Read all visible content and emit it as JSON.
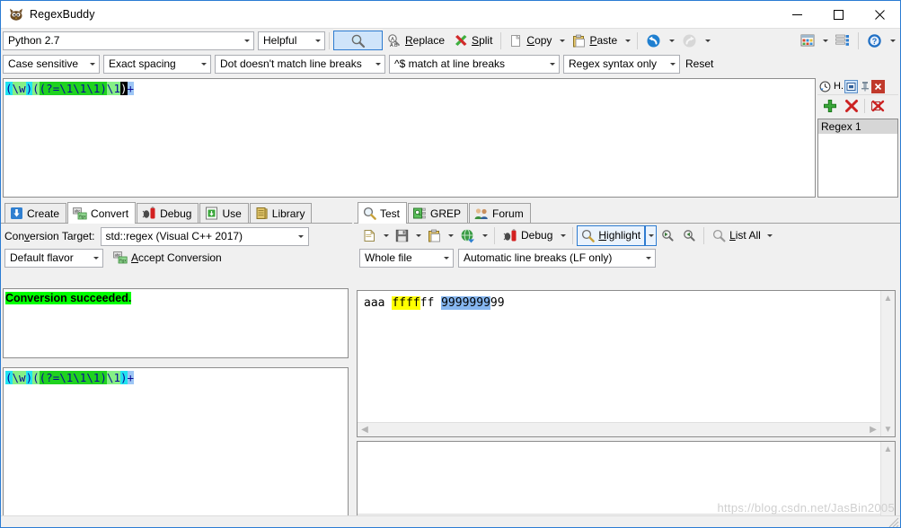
{
  "window": {
    "title": "RegexBuddy",
    "app_icon": "regexbuddy-owl-icon",
    "minimize_label": "Minimize",
    "maximize_label": "Maximize",
    "close_label": "Close"
  },
  "toolbar_main": {
    "flavor": "Python 2.7",
    "mode": "Helpful",
    "search_button": "search-icon",
    "replace_label": "Replace",
    "replace_underline": "R",
    "split_label": "Split",
    "split_underline": "S",
    "copy_label": "Copy",
    "copy_underline": "C",
    "paste_label": "Paste",
    "paste_underline": "P",
    "undo_label": "Undo",
    "redo_label": "Redo",
    "grid_label": "Layout",
    "list_label": "List",
    "help_label": "Help"
  },
  "toolbar_options": {
    "case": "Case sensitive",
    "spacing": "Exact spacing",
    "dot": "Dot doesn't match line breaks",
    "anchors": "^$ match at line breaks",
    "syntax": "Regex syntax only",
    "reset_label": "Reset"
  },
  "regex": {
    "tokens": [
      {
        "text": "(",
        "style": "cy"
      },
      {
        "text": "\\w",
        "style": "lgrn"
      },
      {
        "text": ")",
        "style": "cy"
      },
      {
        "text": "(",
        "style": "lgrn"
      },
      {
        "text": "(",
        "style": "grn"
      },
      {
        "text": "?=",
        "style": "grn"
      },
      {
        "text": "\\1\\1\\1",
        "style": "grn"
      },
      {
        "text": ")",
        "style": "grn"
      },
      {
        "text": "\\1",
        "style": "grn"
      },
      {
        "text": ")",
        "style": "cur"
      },
      {
        "text": "+",
        "style": "blu"
      }
    ],
    "plain": "(\\w)((?=\\1\\1\\1)\\1)+"
  },
  "regex_panel": {
    "header_label": "H.",
    "restore_label": "restore-icon",
    "pin_label": "pin-icon",
    "close_label": "close-icon",
    "add_label": "add-icon",
    "delete_label": "delete-icon",
    "delete_all_label": "delete-all-icon",
    "items": [
      {
        "label": "Regex 1",
        "selected": true
      }
    ]
  },
  "left_pane": {
    "tabs": [
      {
        "label": "Create",
        "icon": "create-icon",
        "selected": false
      },
      {
        "label": "Convert",
        "icon": "convert-icon",
        "selected": true
      },
      {
        "label": "Debug",
        "icon": "debug-icon",
        "selected": false
      },
      {
        "label": "Use",
        "icon": "use-icon",
        "selected": false
      },
      {
        "label": "Library",
        "icon": "library-icon",
        "selected": false
      }
    ],
    "conversion_target_label": "Conversion Target:",
    "conversion_target_underline": "v",
    "conversion_target_value": "std::regex (Visual C++ 2017)",
    "flavor_value": "Default flavor",
    "accept_label": "Accept Conversion",
    "accept_underline": "A",
    "status_message": "Conversion succeeded.",
    "status_bg": "#00ff00",
    "converted_regex": "(\\w)((?=\\1\\1\\1)\\1)+"
  },
  "right_pane": {
    "tabs": [
      {
        "label": "Test",
        "icon": "magnifier-icon",
        "selected": true
      },
      {
        "label": "GREP",
        "icon": "grep-icon",
        "selected": false
      },
      {
        "label": "Forum",
        "icon": "forum-icon",
        "selected": false
      }
    ],
    "toolbar": {
      "new_label": "New",
      "save_label": "Save",
      "paste_label": "Paste",
      "web_label": "Web",
      "debug_label": "Debug",
      "debug_underline": "g",
      "highlight_label": "Highlight",
      "highlight_underline": "H",
      "prev_label": "Find previous",
      "next_label": "Find next",
      "list_all_label": "List All",
      "list_all_underline": "L"
    },
    "scope_value": "Whole file",
    "linebreaks_value": "Automatic line breaks (LF only)",
    "subject": {
      "segments": [
        {
          "text": "aaa ",
          "highlight": "none"
        },
        {
          "text": "ffff",
          "highlight": "yellow"
        },
        {
          "text": "ff ",
          "highlight": "none"
        },
        {
          "text": "9999999",
          "highlight": "blue"
        },
        {
          "text": "99",
          "highlight": "none"
        }
      ],
      "plain": "aaa ffffff 999999999"
    }
  },
  "colors": {
    "accent": "#2b7cd3",
    "match_yellow": "#ffff00",
    "match_blue": "#86b6ef",
    "success_green": "#00ff00",
    "regex_cyan": "#21e3f0",
    "regex_green": "#1fd21f",
    "regex_lightgreen": "#86ef86",
    "regex_blue": "#9dc6f5"
  },
  "watermark": "https://blog.csdn.net/JasBin2005"
}
